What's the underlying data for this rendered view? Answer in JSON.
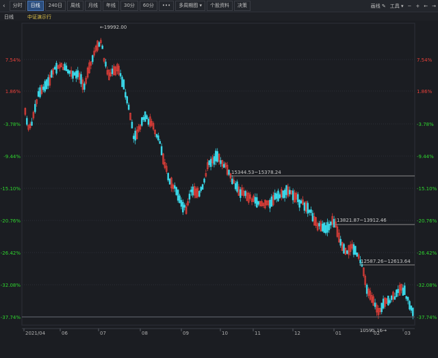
{
  "toolbar": {
    "collapse_icon": "‹",
    "buttons": [
      "分时",
      "日线",
      "240日",
      "周线",
      "月线",
      "年线",
      "30分",
      "60分",
      "•••",
      "多周期图",
      "个股资料",
      "决策"
    ],
    "active_index": 1,
    "draw_label": "画线",
    "tools_label": "工具",
    "dropdown_glyph": "▾"
  },
  "subheader": {
    "period": "日线",
    "stock_name": "中证演示行"
  },
  "colors": {
    "up": "#e8403a",
    "down": "#3ad7e8",
    "grid": "#2c3038",
    "ref_line": "#8c8c8c"
  },
  "chart_data": {
    "type": "candlestick",
    "x_labels": [
      "2021/04",
      "06",
      "07",
      "08",
      "09",
      "10",
      "11",
      "12",
      "01",
      "02",
      "03"
    ],
    "y_labels": [
      "7.54%",
      "1.86%",
      "-3.78%",
      "-9.44%",
      "-15.10%",
      "-20.76%",
      "-26.42%",
      "-32.08%",
      "-37.74%"
    ],
    "y_label_color_split": 2,
    "annotations": {
      "high": "←19992.00",
      "low": "10595.16→",
      "range1": "15344.53~15378.24",
      "range2": "13821.87~13912.46",
      "range3": "12587.26~12613.64"
    },
    "candles": []
  }
}
